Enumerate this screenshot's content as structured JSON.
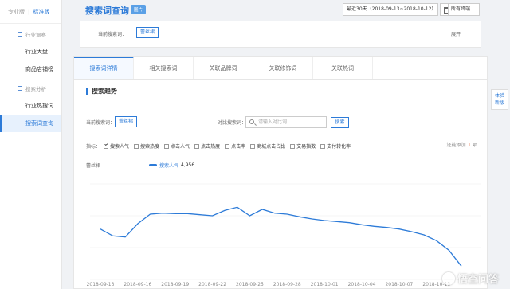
{
  "sidebar": {
    "pro_label": "专业版",
    "std_label": "标准版",
    "sections": [
      {
        "title": "行业洞察",
        "items": [
          "行业大盘",
          "商品店铺榜"
        ]
      },
      {
        "title": "搜索分析",
        "items": [
          "行业热搜词",
          "搜索词查询"
        ]
      }
    ]
  },
  "header": {
    "title": "搜索词查询",
    "badge": "图片",
    "date_range": "最近30天（2018-09-13~2018-10-12）",
    "terminal": "所有终端"
  },
  "filter": {
    "label": "当前搜索词：",
    "keyword": "蕾丝裙",
    "expand": "展开"
  },
  "tabs": [
    "搜索词详情",
    "相关搜索词",
    "关联品牌词",
    "关联修饰词",
    "关联热词"
  ],
  "panel": {
    "title": "搜索趋势",
    "kw_label": "当前搜索词：",
    "kw_value": "蕾丝裙",
    "compare_label": "对比搜索词：",
    "compare_placeholder": "请输入对比词",
    "search_button": "搜索",
    "metrics_label": "指标：",
    "metrics": [
      {
        "label": "搜索人气",
        "checked": true
      },
      {
        "label": "搜索热度",
        "checked": false
      },
      {
        "label": "点击人气",
        "checked": false
      },
      {
        "label": "点击热度",
        "checked": false
      },
      {
        "label": "点击率",
        "checked": false
      },
      {
        "label": "商城点击占比",
        "checked": false
      },
      {
        "label": "交易指数",
        "checked": false
      },
      {
        "label": "支付转化率",
        "checked": false
      }
    ],
    "add_more_prefix": "还能添加",
    "add_more_count": "1",
    "add_more_suffix": "项"
  },
  "side_tab": [
    "体验",
    "新版"
  ],
  "watermark": "悟空问答",
  "chart_data": {
    "type": "line",
    "series": [
      {
        "name": "搜索人气",
        "last_value": "4,956",
        "values": [
          4150,
          4020,
          4000,
          4250,
          4430,
          4450,
          4440,
          4440,
          4420,
          4400,
          4500,
          4560,
          4400,
          4520,
          4450,
          4430,
          4380,
          4340,
          4310,
          4290,
          4270,
          4230,
          4200,
          4180,
          4150,
          4100,
          4040,
          3930,
          3750,
          3450
        ]
      }
    ],
    "x_tick_labels": [
      "2018-09-13",
      "2018-09-16",
      "2018-09-19",
      "2018-09-22",
      "2018-09-25",
      "2018-09-28",
      "2018-10-01",
      "2018-10-04",
      "2018-10-07",
      "2018-10-10"
    ],
    "ylim": [
      3200,
      5000
    ],
    "grid": true,
    "color": "#2d7bd8"
  }
}
